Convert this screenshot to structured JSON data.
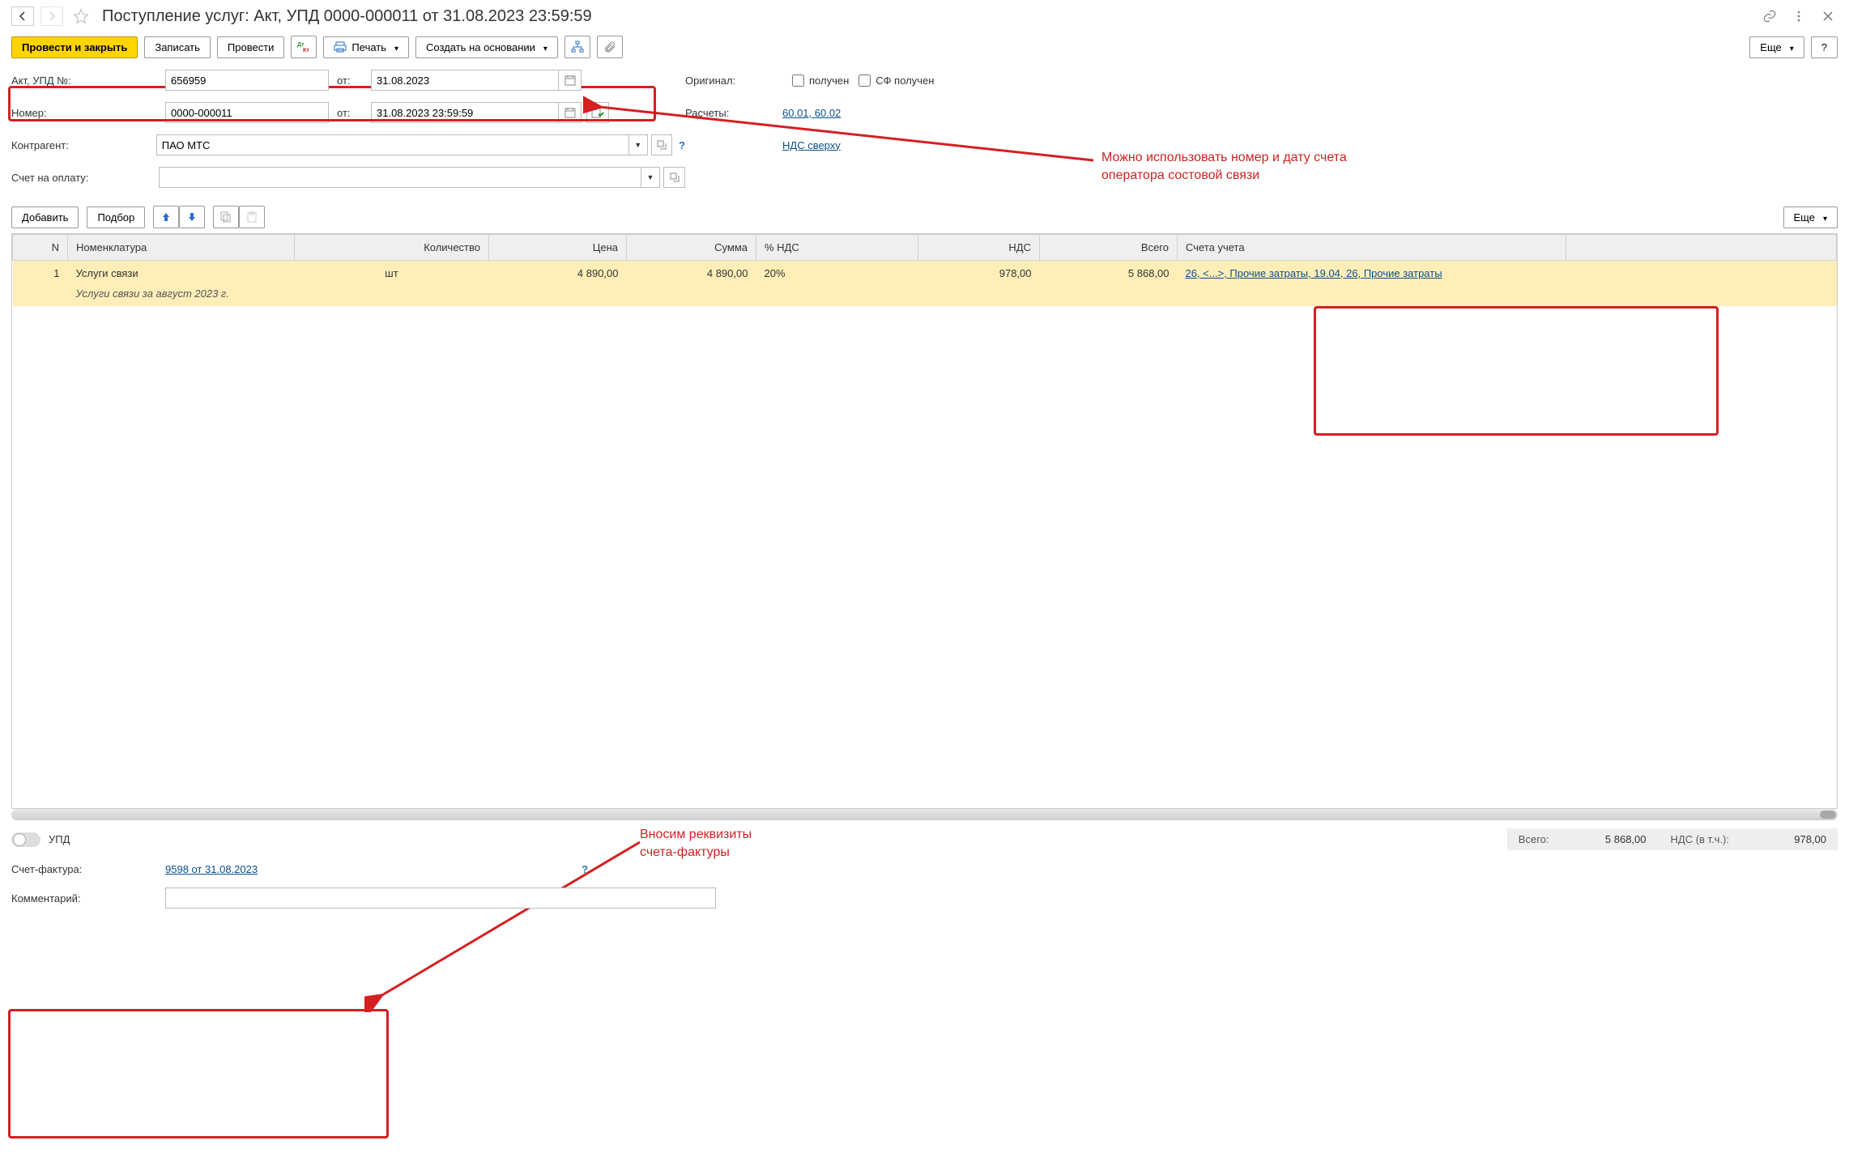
{
  "title": "Поступление услуг: Акт, УПД 0000-000011 от 31.08.2023 23:59:59",
  "nav": {
    "back": "←",
    "fwd": "→"
  },
  "toolbar": {
    "post_close": "Провести и закрыть",
    "save": "Записать",
    "post": "Провести",
    "print": "Печать",
    "create_based": "Создать на основании",
    "more": "Еще",
    "help": "?"
  },
  "form": {
    "akt_label": "Акт, УПД №:",
    "akt_value": "656959",
    "from_label": "от:",
    "akt_date": "31.08.2023",
    "number_label": "Номер:",
    "number_value": "0000-000011",
    "number_date": "31.08.2023 23:59:59",
    "contr_label": "Контрагент:",
    "contr_value": "ПАО МТС",
    "order_label": "Счет на оплату:",
    "order_value": "",
    "original_label": "Оригинал:",
    "received": "получен",
    "sf_received": "СФ получен",
    "settlements_label": "Расчеты:",
    "settlements_link": "60.01, 60.02",
    "vat_link": "НДС сверху"
  },
  "table_toolbar": {
    "add": "Добавить",
    "pick": "Подбор",
    "more": "Еще"
  },
  "columns": {
    "n": "N",
    "nom": "Номенклатура",
    "qty": "Количество",
    "price": "Цена",
    "sum": "Сумма",
    "vat": "% НДС",
    "vatamt": "НДС",
    "total": "Всего",
    "acct": "Счета учета"
  },
  "rows": [
    {
      "n": "1",
      "nom": "Услуги связи",
      "nom_sub": "Услуги связи за август 2023 г.",
      "qty_unit": "шт",
      "price": "4 890,00",
      "sum": "4 890,00",
      "vat": "20%",
      "vatamt": "978,00",
      "total": "5 868,00",
      "acct": "26, <...>, Прочие затраты, 19.04, 26, Прочие затраты"
    }
  ],
  "footer": {
    "upd_label": "УПД",
    "sf_label": "Счет-фактура:",
    "sf_link": "9598 от 31.08.2023",
    "comment_label": "Комментарий:",
    "comment_value": "",
    "total_label": "Всего:",
    "total_value": "5 868,00",
    "vat_label": "НДС (в т.ч.):",
    "vat_value": "978,00"
  },
  "annotations": {
    "note1_line1": "Можно использовать номер и дату счета",
    "note1_line2": "оператора состовой связи",
    "note2_line1": "Вносим реквизиты",
    "note2_line2": "счета-фактуры"
  }
}
